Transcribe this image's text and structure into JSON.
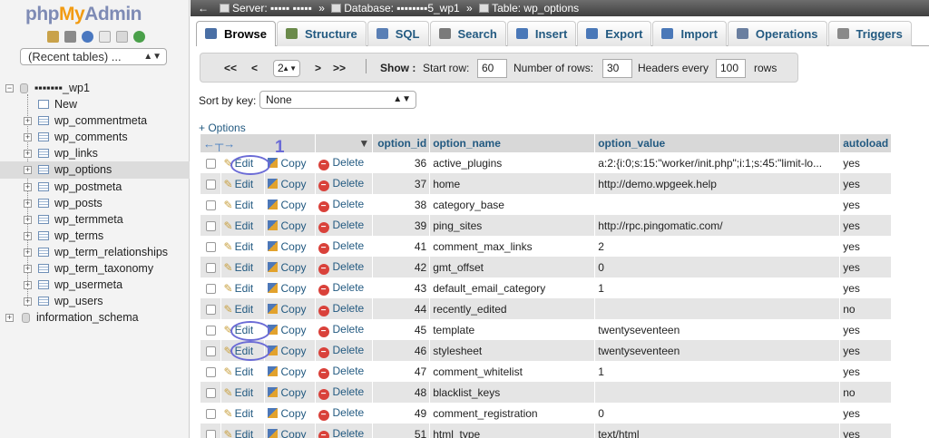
{
  "nav": {
    "logo": {
      "php": "php",
      "my": "My",
      "admin": "Admin"
    },
    "recent_tables": "(Recent tables) ...",
    "db_name": "▪▪▪▪▪▪▪_wp1",
    "new_label": "New",
    "tables": [
      "wp_commentmeta",
      "wp_comments",
      "wp_links",
      "wp_options",
      "wp_postmeta",
      "wp_posts",
      "wp_termmeta",
      "wp_terms",
      "wp_term_relationships",
      "wp_term_taxonomy",
      "wp_usermeta",
      "wp_users"
    ],
    "selected_table": "wp_options",
    "other_db": "information_schema"
  },
  "breadcrumb": {
    "server": "Server: ▪▪▪▪▪ ▪▪▪▪▪",
    "database": "Database: ▪▪▪▪▪▪▪▪5_wp1",
    "table": "Table: wp_options"
  },
  "tabs": [
    {
      "label": "Browse",
      "color": "#4a6fa5"
    },
    {
      "label": "Structure",
      "color": "#6a8a4a"
    },
    {
      "label": "SQL",
      "color": "#5a7fb5"
    },
    {
      "label": "Search",
      "color": "#7a7a7a"
    },
    {
      "label": "Insert",
      "color": "#4a78b8"
    },
    {
      "label": "Export",
      "color": "#4a78b8"
    },
    {
      "label": "Import",
      "color": "#4a78b8"
    },
    {
      "label": "Operations",
      "color": "#6a7fa0"
    },
    {
      "label": "Triggers",
      "color": "#8a8a8a"
    }
  ],
  "navbar": {
    "first": "<<",
    "prev": "<",
    "page": "2",
    "next": ">",
    "last": ">>",
    "show_label": "Show :",
    "start_row_label": "Start row:",
    "start_row": "60",
    "num_rows_label": "Number of rows:",
    "num_rows": "30",
    "headers_label": "Headers every",
    "headers_every": "100",
    "rows_label": "rows"
  },
  "sort": {
    "label": "Sort by key:",
    "value": "None"
  },
  "options_link": "+ Options",
  "columns": [
    "option_id",
    "option_name",
    "option_value",
    "autoload"
  ],
  "actions": {
    "edit": "Edit",
    "copy": "Copy",
    "delete": "Delete"
  },
  "rows": [
    {
      "id": "36",
      "name": "active_plugins",
      "value": "a:2:{i:0;s:15:\"worker/init.php\";i:1;s:45:\"limit-lo...",
      "autoload": "yes"
    },
    {
      "id": "37",
      "name": "home",
      "value": "http://demo.wpgeek.help",
      "autoload": "yes"
    },
    {
      "id": "38",
      "name": "category_base",
      "value": "",
      "autoload": "yes"
    },
    {
      "id": "39",
      "name": "ping_sites",
      "value": "http://rpc.pingomatic.com/",
      "autoload": "yes"
    },
    {
      "id": "41",
      "name": "comment_max_links",
      "value": "2",
      "autoload": "yes"
    },
    {
      "id": "42",
      "name": "gmt_offset",
      "value": "0",
      "autoload": "yes"
    },
    {
      "id": "43",
      "name": "default_email_category",
      "value": "1",
      "autoload": "yes"
    },
    {
      "id": "44",
      "name": "recently_edited",
      "value": "",
      "autoload": "no"
    },
    {
      "id": "45",
      "name": "template",
      "value": "twentyseventeen",
      "autoload": "yes"
    },
    {
      "id": "46",
      "name": "stylesheet",
      "value": "twentyseventeen",
      "autoload": "yes"
    },
    {
      "id": "47",
      "name": "comment_whitelist",
      "value": "1",
      "autoload": "yes"
    },
    {
      "id": "48",
      "name": "blacklist_keys",
      "value": "",
      "autoload": "no"
    },
    {
      "id": "49",
      "name": "comment_registration",
      "value": "0",
      "autoload": "yes"
    },
    {
      "id": "51",
      "name": "html_type",
      "value": "text/html",
      "autoload": "yes"
    }
  ],
  "annotation": {
    "number": "1",
    "color": "#6b6bd6"
  }
}
